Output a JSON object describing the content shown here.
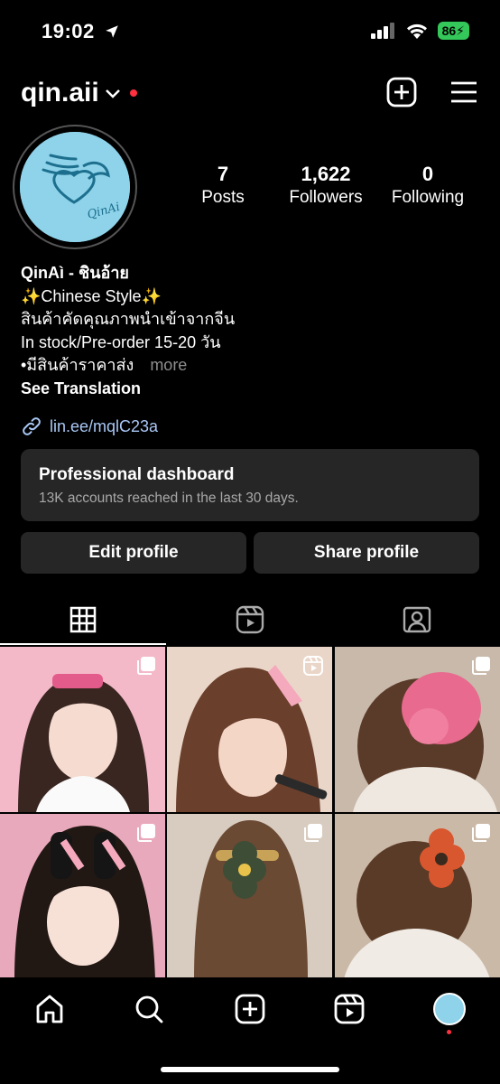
{
  "status_bar": {
    "time": "19:02",
    "battery": "86"
  },
  "header": {
    "username": "qin.aii"
  },
  "stats": [
    {
      "value": "7",
      "label": "Posts"
    },
    {
      "value": "1,622",
      "label": "Followers"
    },
    {
      "value": "0",
      "label": "Following"
    }
  ],
  "avatar": {
    "brand_text": "QinAi"
  },
  "bio": {
    "name": "QinAì - ชินอ้าย",
    "lines": [
      "✨Chinese Style✨",
      "สินค้าคัดคุณภาพนำเข้าจากจีน",
      "In stock/Pre-order 15-20 วัน",
      "•มีสินค้าราคาส่ง"
    ],
    "more": "more",
    "see_translation": "See Translation",
    "link": "lin.ee/mqlC23a"
  },
  "dashboard": {
    "title": "Professional dashboard",
    "subtitle": "13K accounts reached in the last 30 days."
  },
  "buttons": {
    "edit": "Edit profile",
    "share": "Share profile"
  },
  "colors": {
    "accent": "#0095f6",
    "link": "#a9c7f5",
    "card_bg": "#262626",
    "notification": "#ff3040"
  }
}
